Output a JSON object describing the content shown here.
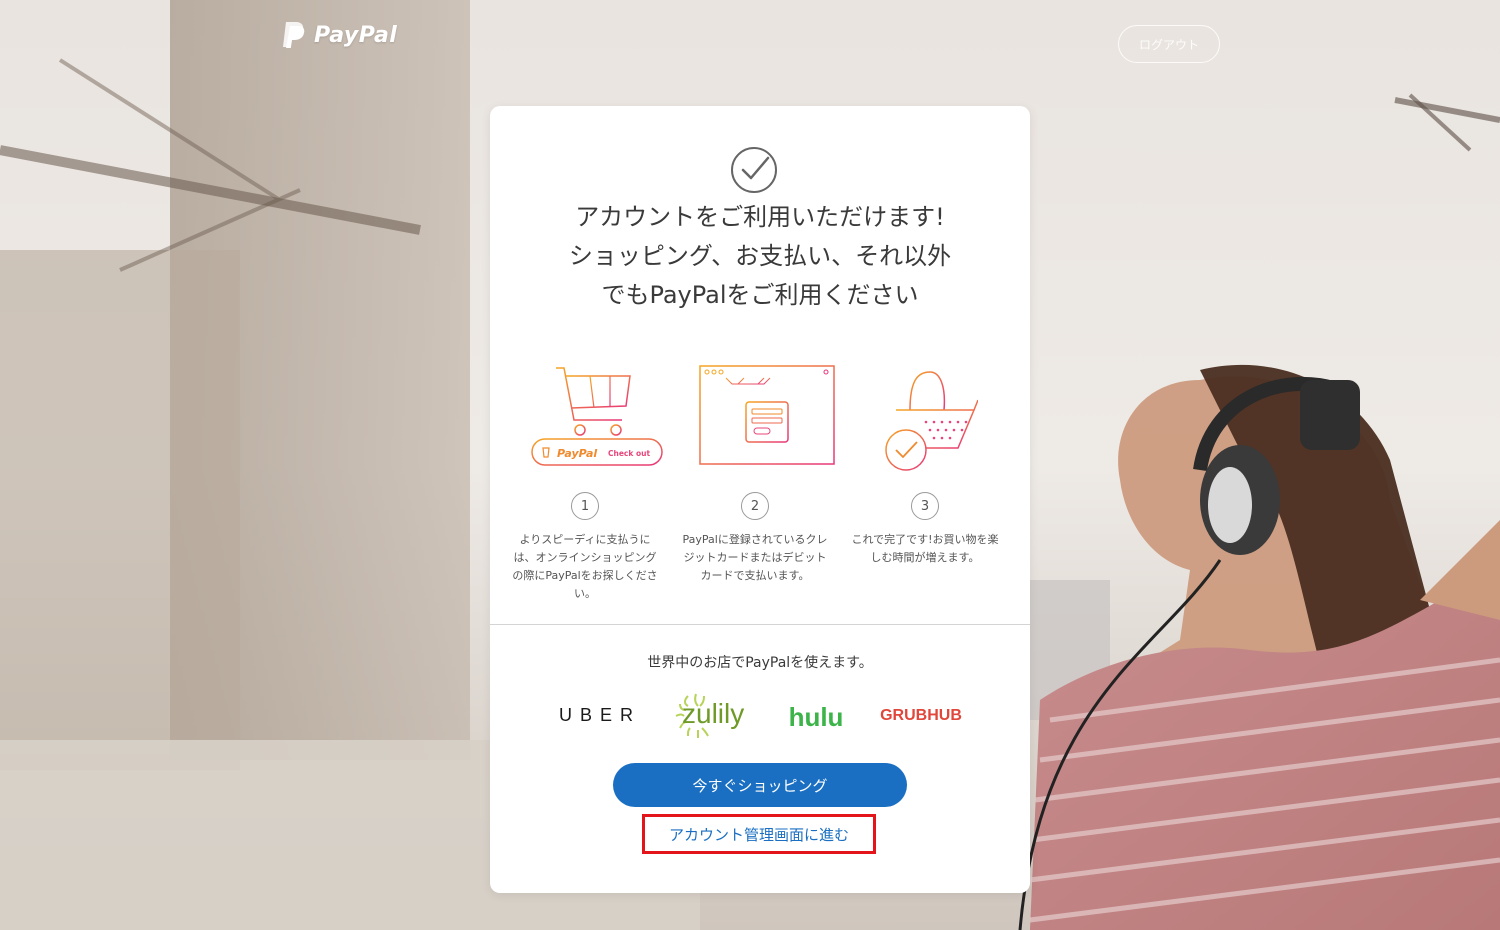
{
  "header": {
    "brand": "PayPal",
    "logout_label": "ログアウト"
  },
  "card": {
    "headline_lines": [
      "アカウントをご利用いただけます!",
      "ショッピング、お支払い、それ以外",
      "でもPayPalをご利用ください"
    ],
    "steps": [
      {
        "number": "1",
        "text": "よりスピーディに支払うには、オンラインショッピングの際にPayPalをお探しください。",
        "illustration": "shopping-cart-icon",
        "button_brand": "PayPal",
        "button_label": "Check out"
      },
      {
        "number": "2",
        "text": "PayPalに登録されているクレジットカードまたはデビットカードで支払います。",
        "illustration": "browser-form-icon"
      },
      {
        "number": "3",
        "text": "これで完了です!お買い物を楽しむ時間が増えます。",
        "illustration": "basket-check-icon"
      }
    ],
    "merchants_title": "世界中のお店でPayPalを使えます。",
    "merchants": [
      "UBER",
      "zulily",
      "hulu",
      "GRUBHUB"
    ],
    "shop_now_label": "今すぐショッピング",
    "account_link_label": "アカウント管理画面に進む"
  },
  "colors": {
    "primary": "#1a6fc2",
    "highlight_border": "#e4141b",
    "gradient_start": "#f5a623",
    "gradient_end": "#e8367a"
  }
}
